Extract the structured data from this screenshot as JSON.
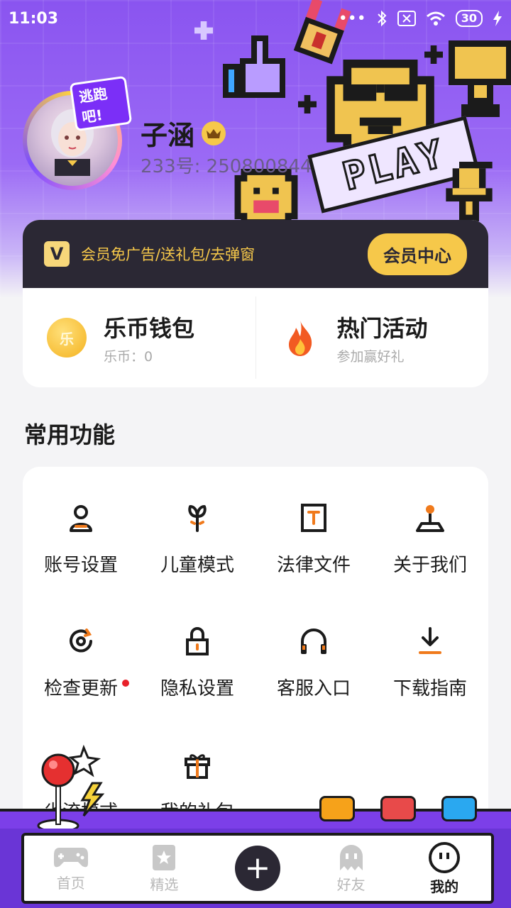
{
  "status_bar": {
    "time": "11:03",
    "battery": "30"
  },
  "profile": {
    "avatar_badge": "逃跑吧!",
    "username": "子涵",
    "uid": "233号: 250800844",
    "hero_sign": "PLAY"
  },
  "vip": {
    "logo": "V",
    "text": "会员免广告/送礼包/去弹窗",
    "button": "会员中心"
  },
  "wallet": {
    "icon_text": "乐",
    "title": "乐币钱包",
    "subtitle": "乐币：0"
  },
  "activity": {
    "title": "热门活动",
    "subtitle": "参加赢好礼"
  },
  "section": {
    "title": "常用功能"
  },
  "functions": [
    {
      "label": "账号设置",
      "icon": "user-icon"
    },
    {
      "label": "儿童模式",
      "icon": "sprout-icon"
    },
    {
      "label": "法律文件",
      "icon": "document-icon"
    },
    {
      "label": "关于我们",
      "icon": "joystick-icon"
    },
    {
      "label": "检查更新",
      "icon": "refresh-icon",
      "badge": true
    },
    {
      "label": "隐私设置",
      "icon": "lock-icon"
    },
    {
      "label": "客服入口",
      "icon": "headphones-icon"
    },
    {
      "label": "下载指南",
      "icon": "download-icon"
    },
    {
      "label": "省流模式",
      "icon": "joystick-ball-icon"
    },
    {
      "label": "我的礼包",
      "icon": "gift-icon"
    }
  ],
  "nav": {
    "home": "首页",
    "featured": "精选",
    "friends": "好友",
    "me": "我的"
  },
  "colors": {
    "brand_purple": "#8a54f0",
    "vip_dark": "#2b2834",
    "vip_gold": "#f6c84a",
    "accent_orange": "#f07a1c",
    "badge_red": "#e8202a"
  }
}
